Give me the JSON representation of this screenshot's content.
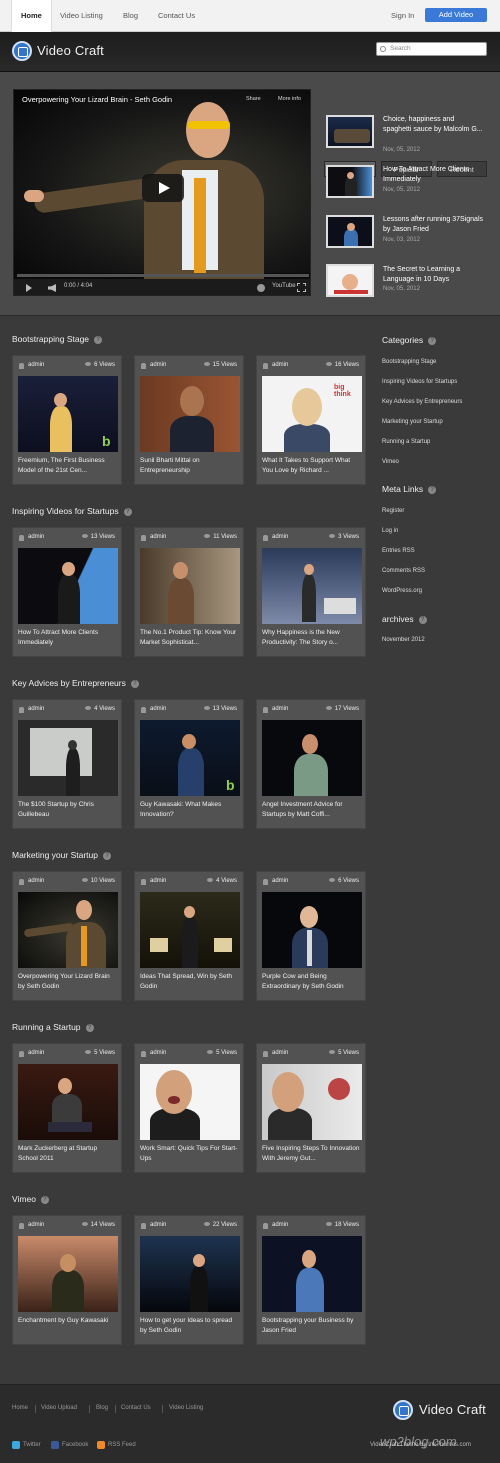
{
  "topnav": {
    "items": [
      "Home",
      "Video Listing",
      "Blog",
      "Contact Us"
    ],
    "signin": "Sign In",
    "add_video": "Add Video"
  },
  "header": {
    "logo": "Video Craft",
    "search_placeholder": "Search"
  },
  "player": {
    "title": "Overpowering Your Lizard Brain - Seth Godin",
    "share": "Share",
    "more_info": "More info",
    "time": "0:00 / 4:04",
    "youtube": "YouTube"
  },
  "tabs": [
    "Related",
    "Popular",
    "Recent"
  ],
  "related": [
    {
      "title": "Choice, happiness and spaghetti sauce by Malcolm G...",
      "date": "Nov, 05, 2012"
    },
    {
      "title": "How To Attract More Clients Immediately",
      "date": "Nov, 05, 2012"
    },
    {
      "title": "Lessons after running 37Signals by Jason Fried",
      "date": "Nov, 03, 2012"
    },
    {
      "title": "The Secret to Learning a Language in 10 Days",
      "date": "Nov, 05, 2012"
    }
  ],
  "sections": [
    {
      "title": "Bootstrapping Stage",
      "cards": [
        {
          "author": "admin",
          "views": "6 Views",
          "title": "Freemium, The First Business Model of the 21st Cen..."
        },
        {
          "author": "admin",
          "views": "15 Views",
          "title": "Sunil Bharti Mittal on Entrepreneurship"
        },
        {
          "author": "admin",
          "views": "16 Views",
          "title": "What It Takes to Support What You Love by Richard ..."
        }
      ]
    },
    {
      "title": "Inspiring Videos for Startups",
      "cards": [
        {
          "author": "admin",
          "views": "13 Views",
          "title": "How To Attract More Clients Immediately"
        },
        {
          "author": "admin",
          "views": "11 Views",
          "title": "The No.1 Product Tip: Know Your Market Sophisticat..."
        },
        {
          "author": "admin",
          "views": "3 Views",
          "title": "Why Happiness is the New Productivity: The Story o..."
        }
      ]
    },
    {
      "title": "Key Advices by Entrepreneurs",
      "cards": [
        {
          "author": "admin",
          "views": "4 Views",
          "title": "The $100 Startup by Chris Guillebeau"
        },
        {
          "author": "admin",
          "views": "13 Views",
          "title": "Guy Kawasaki: What Makes Innovation?"
        },
        {
          "author": "admin",
          "views": "17 Views",
          "title": "Angel Investment Advice for Startups by Matt Coffi..."
        }
      ]
    },
    {
      "title": "Marketing your Startup",
      "cards": [
        {
          "author": "admin",
          "views": "10 Views",
          "title": "Overpowering Your Lizard Brain by Seth Godin"
        },
        {
          "author": "admin",
          "views": "4 Views",
          "title": "Ideas That Spread, Win by Seth Godin"
        },
        {
          "author": "admin",
          "views": "6 Views",
          "title": "Purple Cow and Being Extraordinary by Seth Godin"
        }
      ]
    },
    {
      "title": "Running a Startup",
      "cards": [
        {
          "author": "admin",
          "views": "5 Views",
          "title": "Mark Zuckerberg at Startup School 2011"
        },
        {
          "author": "admin",
          "views": "5 Views",
          "title": "Work Smart: Quick Tips For Start-Ups"
        },
        {
          "author": "admin",
          "views": "5 Views",
          "title": "Five Inspiring Steps To Innovation With Jeremy Gut..."
        }
      ]
    },
    {
      "title": "Vimeo",
      "cards": [
        {
          "author": "admin",
          "views": "14 Views",
          "title": "Enchantment by Guy Kawasaki"
        },
        {
          "author": "admin",
          "views": "22 Views",
          "title": "How to get your Ideas to spread by Seth Godin"
        },
        {
          "author": "admin",
          "views": "18 Views",
          "title": "Bootstrapping your Business by Jason Fried"
        }
      ]
    }
  ],
  "sidebar": {
    "categories_title": "Categories",
    "categories": [
      "Bootstrapping Stage",
      "Inspiring Videos for Startups",
      "Key Advices by Entrepreneurs",
      "Marketing your Startup",
      "Running a Startup",
      "Vimeo"
    ],
    "meta_title": "Meta Links",
    "meta": [
      "Register",
      "Log in",
      "Entries RSS",
      "Comments RSS",
      "WordPress.org"
    ],
    "archives_title": "archives",
    "archives": [
      "November 2012"
    ]
  },
  "footer": {
    "links": [
      "Home",
      "Video Upload",
      "Blog",
      "Contact Us",
      "Video Listing"
    ],
    "logo": "Video Craft",
    "social": [
      "Twitter",
      "Facebook",
      "RSS Feed"
    ],
    "credit": "VideoCraft Theme by InkThemes.com",
    "watermark": "wp2blog.com"
  },
  "colors": {
    "accent": "#3b79d9",
    "background": "#3a3a3a",
    "card": "#525252"
  }
}
